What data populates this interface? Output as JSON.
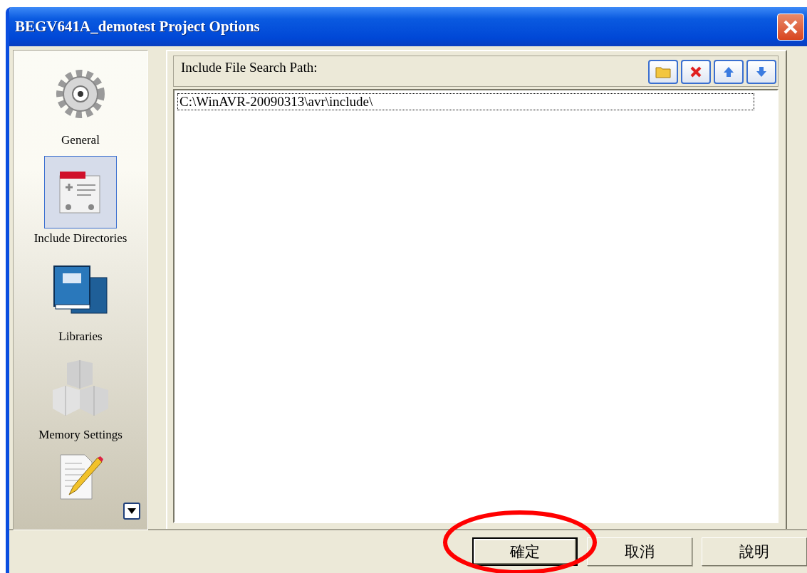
{
  "window": {
    "title": "BEGV641A_demotest Project Options"
  },
  "sidebar": {
    "items": [
      {
        "label": "General",
        "selected": false
      },
      {
        "label": "Include Directories",
        "selected": true
      },
      {
        "label": "Libraries",
        "selected": false
      },
      {
        "label": "Memory Settings",
        "selected": false
      }
    ]
  },
  "include_paths": {
    "heading": "Include File Search Path:",
    "paths": [
      {
        "text": "C:\\WinAVR-20090313\\avr\\include\\",
        "selected": true
      }
    ]
  },
  "buttons": [
    {
      "label": "確定",
      "default": true
    },
    {
      "label": "取消",
      "default": false
    },
    {
      "label": "說明",
      "default": false
    }
  ],
  "annotations": [
    {
      "kind": "ellipse"
    }
  ]
}
